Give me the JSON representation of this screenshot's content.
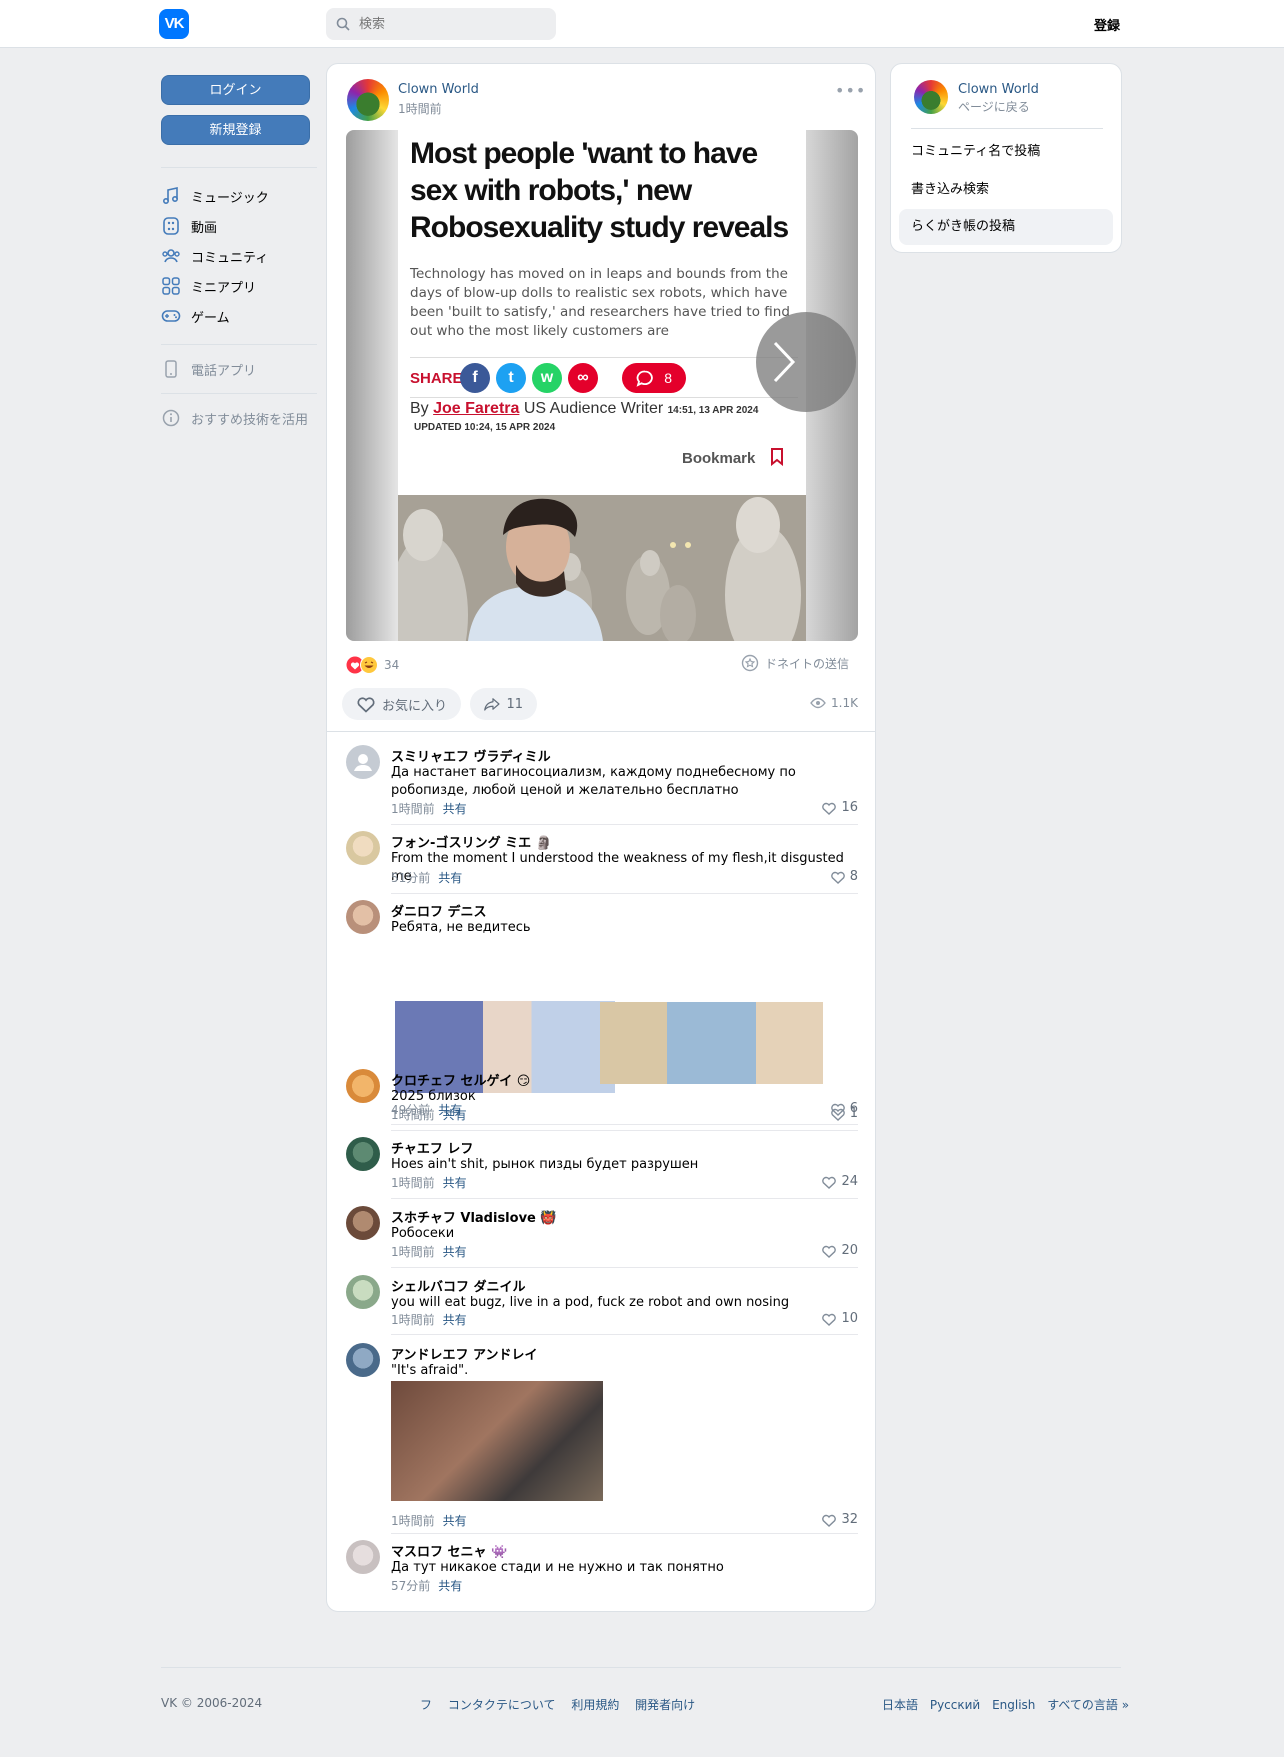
{
  "header": {
    "logo": "VK",
    "search_placeholder": "検索",
    "register": "登録"
  },
  "left_nav": {
    "login": "ログイン",
    "signup": "新規登録",
    "items": [
      {
        "label": "ミュージック",
        "icon": "music-icon"
      },
      {
        "label": "動画",
        "icon": "video-icon"
      },
      {
        "label": "コミュニティ",
        "icon": "community-icon"
      },
      {
        "label": "ミニアプリ",
        "icon": "mini-apps-icon"
      },
      {
        "label": "ゲーム",
        "icon": "gamepad-icon"
      }
    ],
    "phone_app": "電話アプリ",
    "recommend": "おすすめ技術を活用"
  },
  "post": {
    "author": "Clown World",
    "time": "1時間前",
    "article": {
      "title": "Most people 'want to have sex with robots,' new Robosexuality study reveals",
      "description": "Technology has moved on in leaps and bounds from the days of blow-up dolls to realistic sex robots, which have been 'built to satisfy,' and researchers have tried to find out who the most likely customers are",
      "share_label": "SHARE",
      "social": [
        "f",
        "t",
        "w",
        "∞"
      ],
      "comment_count": "8",
      "by": "By",
      "author": "Joe Faretra",
      "role": "US Audience Writer",
      "date": "14:51, 13 APR 2024",
      "updated": "UPDATED 10:24, 15 APR 2024",
      "bookmark": "Bookmark"
    },
    "reactions_count": "34",
    "donate": "ドネイトの送信",
    "like_label": "お気に入り",
    "shares_count": "11",
    "views": "1.1K"
  },
  "comments": [
    {
      "name": "スミリャエフ ヴラディミル",
      "text": "Да настанет вагиносоциализм, каждому поднебесному по робопизде, любой ценой и желательно бесплатно",
      "time": "1時間前",
      "share": "共有",
      "likes": "16",
      "avatar_color": "#c5cbd3"
    },
    {
      "name": "フォン-ゴスリング ミエ 🗿",
      "text": "From the moment I understood the weakness of my flesh,it disgusted me",
      "time": "51分前",
      "share": "共有",
      "likes": "8",
      "avatar_color": "#d9c8a0"
    },
    {
      "name": "ダニロフ デニス",
      "text": "Ребята, не ведитесь",
      "time": "49分前",
      "share": "共有",
      "likes": "6",
      "avatar_color": "#c9a48a"
    },
    {
      "name": "クロチェフ セルゲイ 😏",
      "text": "2025 близок",
      "time": "1時間前",
      "share": "共有",
      "likes": "1",
      "avatar_color": "#e09a4a"
    },
    {
      "name": "チャエフ レフ",
      "text": "Hoes ain't shit, рынок пизды будет разрушен",
      "time": "1時間前",
      "share": "共有",
      "likes": "24",
      "avatar_color": "#2f5d4a"
    },
    {
      "name": "スホチャフ Vladislove 👹",
      "text": "Робосеки",
      "time": "1時間前",
      "share": "共有",
      "likes": "20",
      "avatar_color": "#6b4a3a"
    },
    {
      "name": "シェルバコフ ダニイル",
      "text": "you will eat bugz, live in a pod, fuck ze robot and own nosing",
      "time": "1時間前",
      "share": "共有",
      "likes": "10",
      "avatar_color": "#8aa88a"
    },
    {
      "name": "アンドレエフ アンドレイ",
      "text": "\"It's afraid\".",
      "time": "1時間前",
      "share": "共有",
      "likes": "32",
      "avatar_color": "#4a6a8a"
    },
    {
      "name": "マスロフ セニャ 👾",
      "text": "Да тут никакое стади и не нужно и так понятно",
      "time": "57分前",
      "share": "共有",
      "likes": "",
      "avatar_color": "#c8c0c0"
    }
  ],
  "right_panel": {
    "name": "Clown World",
    "back": "ページに戻る",
    "items": [
      "コミュニティ名で投稿",
      "書き込み検索",
      "らくがき帳の投稿"
    ]
  },
  "footer": {
    "copyright": "VK © 2006-2024",
    "links": [
      "フ",
      "コンタクテについて",
      "利用規約",
      "開発者向け"
    ],
    "languages": [
      "日本語",
      "Русский",
      "English",
      "すべての言語 »"
    ]
  },
  "colors": {
    "accent": "#447bba",
    "link": "#2a5885",
    "brand": "#0077ff",
    "article_red": "#c8102e"
  }
}
